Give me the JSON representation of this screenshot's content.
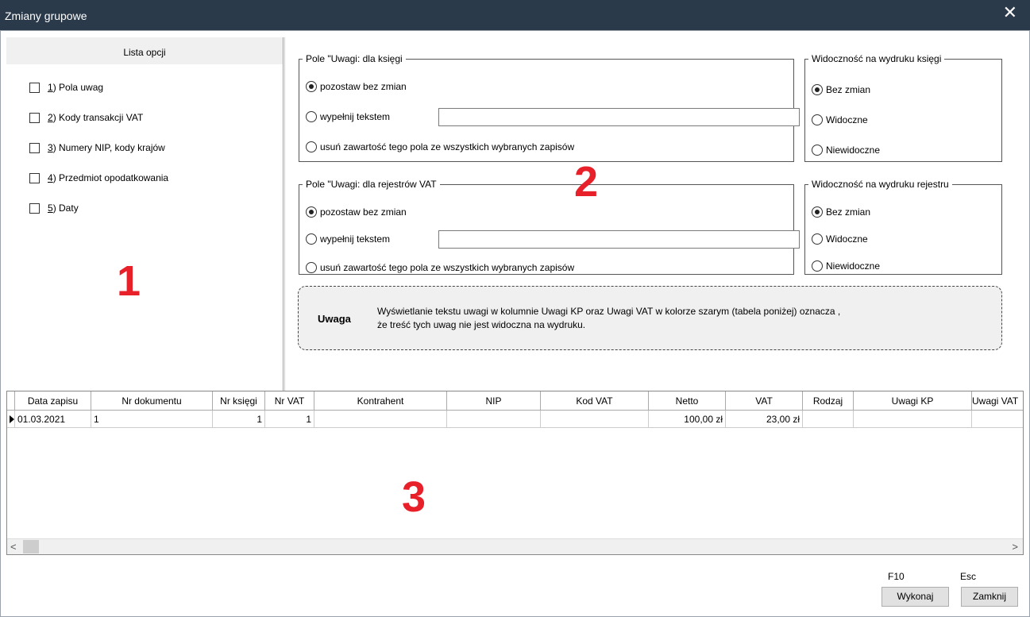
{
  "window": {
    "title": "Zmiany grupowe"
  },
  "left_panel": {
    "header": "Lista opcji",
    "options": [
      {
        "key": "1",
        "text": ") Pola uwag"
      },
      {
        "key": "2",
        "text": ") Kody transakcji VAT"
      },
      {
        "key": "3",
        "text": ") Numery NIP, kody krajów"
      },
      {
        "key": "4",
        "text": ") Przedmiot opodatkowania"
      },
      {
        "key": "5",
        "text": ") Daty"
      }
    ]
  },
  "group_ksiega": {
    "legend": "Pole \"Uwagi:  dla księgi",
    "options": [
      "pozostaw bez zmian",
      "wypełnij tekstem",
      "usuń zawartość tego pola ze wszystkich wybranych zapisów"
    ],
    "selected": 0,
    "text_value": ""
  },
  "group_vat": {
    "legend": "Pole \"Uwagi:  dla rejestrów VAT",
    "options": [
      "pozostaw bez zmian",
      "wypełnij tekstem",
      "usuń zawartość tego pola ze wszystkich wybranych zapisów"
    ],
    "selected": 0,
    "text_value": ""
  },
  "vis_ksiega": {
    "legend": "Widoczność na wydruku księgi",
    "options": [
      "Bez zmian",
      "Widoczne",
      "Niewidoczne"
    ],
    "selected": 0
  },
  "vis_rejestr": {
    "legend": "Widoczność na wydruku rejestru",
    "options": [
      "Bez zmian",
      "Widoczne",
      "Niewidoczne"
    ],
    "selected": 0
  },
  "note": {
    "label": "Uwaga",
    "line1": "Wyświetlanie tekstu uwagi w kolumnie Uwagi KP oraz Uwagi VAT w kolorze szarym (tabela poniżej) oznacza ,",
    "line2": "że treść tych uwag nie jest widoczna na wydruku."
  },
  "annotations": [
    "1",
    "2",
    "3"
  ],
  "table": {
    "columns": [
      "Data zapisu",
      "Nr dokumentu",
      "Nr księgi",
      "Nr VAT",
      "Kontrahent",
      "NIP",
      "Kod VAT",
      "Netto",
      "VAT",
      "Rodzaj",
      "Uwagi KP",
      "Uwagi VAT"
    ],
    "rows": [
      [
        "01.03.2021",
        "1",
        "1",
        "1",
        "",
        "",
        "",
        "100,00 zł",
        "23,00 zł",
        "",
        "",
        ""
      ]
    ]
  },
  "footer": {
    "execute_key": "F10",
    "execute_label": "Wykonaj",
    "close_key": "Esc",
    "close_label": "Zamknij"
  },
  "colors": {
    "titlebar": "#2b3a4a",
    "annotation": "#e8202a",
    "note_bg": "#f0f0f0"
  }
}
